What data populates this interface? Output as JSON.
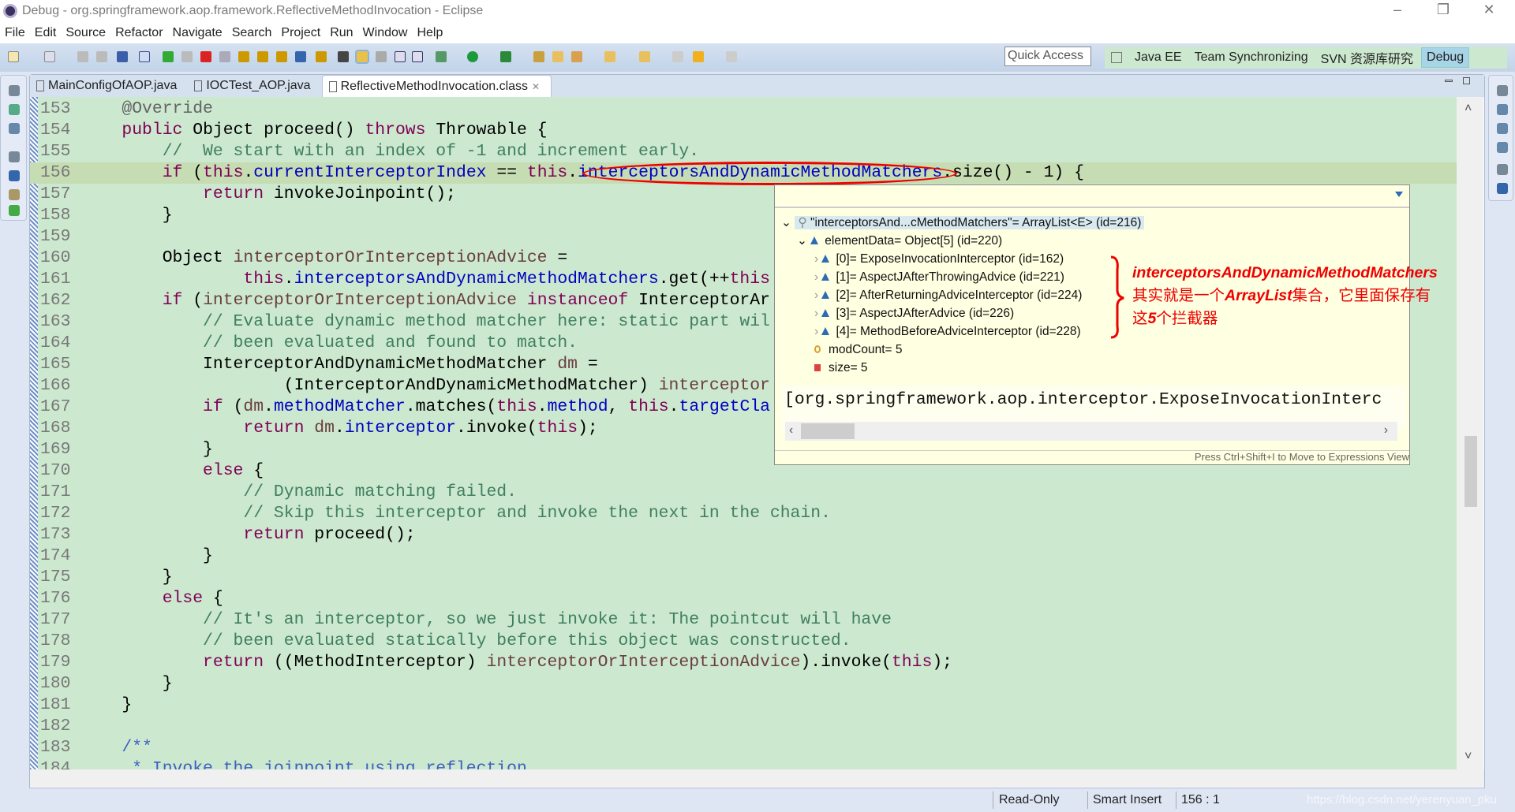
{
  "window": {
    "title": "Debug - org.springframework.aop.framework.ReflectiveMethodInvocation - Eclipse",
    "minimize": "–",
    "restore": "❐",
    "close": "✕"
  },
  "menu": [
    "File",
    "Edit",
    "Source",
    "Refactor",
    "Navigate",
    "Search",
    "Project",
    "Run",
    "Window",
    "Help"
  ],
  "toolbar": {
    "quick_access": "Quick Access",
    "perspectives": [
      "Java EE",
      "Team Synchronizing",
      "SVN 资源库研究",
      "Debug"
    ],
    "active_perspective": "Debug"
  },
  "tabs": [
    {
      "label": "MainConfigOfAOP.java"
    },
    {
      "label": "IOCTest_AOP.java"
    },
    {
      "label": "ReflectiveMethodInvocation.class",
      "active": true,
      "close": "✕"
    }
  ],
  "code": [
    {
      "n": "153",
      "t": [
        [
          "p",
          "    "
        ],
        [
          "a",
          "@Override"
        ]
      ]
    },
    {
      "n": "154",
      "t": [
        [
          "p",
          "    "
        ],
        [
          "k",
          "public"
        ],
        [
          "p",
          " Object proceed() "
        ],
        [
          "k",
          "throws"
        ],
        [
          "p",
          " Throwable {"
        ]
      ]
    },
    {
      "n": "155",
      "t": [
        [
          "p",
          "        "
        ],
        [
          "c",
          "//  We start with an index of -1 and increment early."
        ]
      ]
    },
    {
      "n": "156",
      "hl": true,
      "t": [
        [
          "p",
          "        "
        ],
        [
          "k",
          "if"
        ],
        [
          "p",
          " ("
        ],
        [
          "k",
          "this"
        ],
        [
          "p",
          "."
        ],
        [
          "f",
          "currentInterceptorIndex"
        ],
        [
          "p",
          " == "
        ],
        [
          "k",
          "this"
        ],
        [
          "p",
          "."
        ],
        [
          "f",
          "interceptorsAndDynamicMethodMatchers"
        ],
        [
          "p",
          ".size() - 1) {"
        ]
      ]
    },
    {
      "n": "157",
      "t": [
        [
          "p",
          "            "
        ],
        [
          "k",
          "return"
        ],
        [
          "p",
          " invokeJoinpoint();"
        ]
      ]
    },
    {
      "n": "158",
      "t": [
        [
          "p",
          "        }"
        ]
      ]
    },
    {
      "n": "159",
      "t": []
    },
    {
      "n": "160",
      "t": [
        [
          "p",
          "        Object "
        ],
        [
          "v",
          "interceptorOrInterceptionAdvice"
        ],
        [
          "p",
          " ="
        ]
      ]
    },
    {
      "n": "161",
      "t": [
        [
          "p",
          "                "
        ],
        [
          "k",
          "this"
        ],
        [
          "p",
          "."
        ],
        [
          "f",
          "interceptorsAndDynamicMethodMatchers"
        ],
        [
          "p",
          ".get(++"
        ],
        [
          "k",
          "this"
        ]
      ]
    },
    {
      "n": "162",
      "t": [
        [
          "p",
          "        "
        ],
        [
          "k",
          "if"
        ],
        [
          "p",
          " ("
        ],
        [
          "v",
          "interceptorOrInterceptionAdvice"
        ],
        [
          "p",
          " "
        ],
        [
          "k",
          "instanceof"
        ],
        [
          "p",
          " InterceptorAr"
        ]
      ]
    },
    {
      "n": "163",
      "t": [
        [
          "p",
          "            "
        ],
        [
          "c",
          "// Evaluate dynamic method matcher here: static part wil"
        ]
      ]
    },
    {
      "n": "164",
      "t": [
        [
          "p",
          "            "
        ],
        [
          "c",
          "// been evaluated and found to match."
        ]
      ]
    },
    {
      "n": "165",
      "t": [
        [
          "p",
          "            InterceptorAndDynamicMethodMatcher "
        ],
        [
          "v",
          "dm"
        ],
        [
          "p",
          " ="
        ]
      ]
    },
    {
      "n": "166",
      "t": [
        [
          "p",
          "                    (InterceptorAndDynamicMethodMatcher) "
        ],
        [
          "v",
          "interceptor"
        ]
      ]
    },
    {
      "n": "167",
      "t": [
        [
          "p",
          "            "
        ],
        [
          "k",
          "if"
        ],
        [
          "p",
          " ("
        ],
        [
          "v",
          "dm"
        ],
        [
          "p",
          "."
        ],
        [
          "f",
          "methodMatcher"
        ],
        [
          "p",
          ".matches("
        ],
        [
          "k",
          "this"
        ],
        [
          "p",
          "."
        ],
        [
          "f",
          "method"
        ],
        [
          "p",
          ", "
        ],
        [
          "k",
          "this"
        ],
        [
          "p",
          "."
        ],
        [
          "f",
          "targetCla"
        ]
      ]
    },
    {
      "n": "168",
      "t": [
        [
          "p",
          "                "
        ],
        [
          "k",
          "return"
        ],
        [
          "p",
          " "
        ],
        [
          "v",
          "dm"
        ],
        [
          "p",
          "."
        ],
        [
          "f",
          "interceptor"
        ],
        [
          "p",
          ".invoke("
        ],
        [
          "k",
          "this"
        ],
        [
          "p",
          ");"
        ]
      ]
    },
    {
      "n": "169",
      "t": [
        [
          "p",
          "            }"
        ]
      ]
    },
    {
      "n": "170",
      "t": [
        [
          "p",
          "            "
        ],
        [
          "k",
          "else"
        ],
        [
          "p",
          " {"
        ]
      ]
    },
    {
      "n": "171",
      "t": [
        [
          "p",
          "                "
        ],
        [
          "c",
          "// Dynamic matching failed."
        ]
      ]
    },
    {
      "n": "172",
      "t": [
        [
          "p",
          "                "
        ],
        [
          "c",
          "// Skip this interceptor and invoke the next in the chain."
        ]
      ]
    },
    {
      "n": "173",
      "t": [
        [
          "p",
          "                "
        ],
        [
          "k",
          "return"
        ],
        [
          "p",
          " proceed();"
        ]
      ]
    },
    {
      "n": "174",
      "t": [
        [
          "p",
          "            }"
        ]
      ]
    },
    {
      "n": "175",
      "t": [
        [
          "p",
          "        }"
        ]
      ]
    },
    {
      "n": "176",
      "t": [
        [
          "p",
          "        "
        ],
        [
          "k",
          "else"
        ],
        [
          "p",
          " {"
        ]
      ]
    },
    {
      "n": "177",
      "t": [
        [
          "p",
          "            "
        ],
        [
          "c",
          "// It's an interceptor, so we just invoke it: The pointcut will have"
        ]
      ]
    },
    {
      "n": "178",
      "t": [
        [
          "p",
          "            "
        ],
        [
          "c",
          "// been evaluated statically before this object was constructed."
        ]
      ]
    },
    {
      "n": "179",
      "t": [
        [
          "p",
          "            "
        ],
        [
          "k",
          "return"
        ],
        [
          "p",
          " ((MethodInterceptor) "
        ],
        [
          "v",
          "interceptorOrInterceptionAdvice"
        ],
        [
          "p",
          ").invoke("
        ],
        [
          "k",
          "this"
        ],
        [
          "p",
          ");"
        ]
      ]
    },
    {
      "n": "180",
      "t": [
        [
          "p",
          "        }"
        ]
      ]
    },
    {
      "n": "181",
      "t": [
        [
          "p",
          "    }"
        ]
      ]
    },
    {
      "n": "182",
      "t": []
    },
    {
      "n": "183",
      "t": [
        [
          "p",
          "    "
        ],
        [
          "d",
          "/**"
        ]
      ]
    },
    {
      "n": "184",
      "t": [
        [
          "p",
          "     "
        ],
        [
          "d",
          "* Invoke the joinpoint using reflection."
        ]
      ]
    }
  ],
  "popup": {
    "root": "\"interceptorsAnd...cMethodMatchers\"= ArrayList<E>  (id=216)",
    "elementData": "elementData= Object[5]  (id=220)",
    "items": [
      "[0]= ExposeInvocationInterceptor  (id=162)",
      "[1]= AspectJAfterThrowingAdvice  (id=221)",
      "[2]= AfterReturningAdviceInterceptor  (id=224)",
      "[3]= AspectJAfterAdvice  (id=226)",
      "[4]= MethodBeforeAdviceInterceptor  (id=228)"
    ],
    "modCount": "modCount= 5",
    "size": "size= 5",
    "detail": "[org.springframework.aop.interceptor.ExposeInvocationInterc",
    "footer": "Press Ctrl+Shift+I to Move to Expressions View"
  },
  "annotation": {
    "line1": "interceptorsAndDynamicMethodMatchers",
    "line2a": "其实就是一个",
    "line2b": "ArrayList",
    "line2c": "集合，它里面保存有",
    "line3a": "这",
    "line3b": "5",
    "line3c": "个拦截器",
    "color": "#e00000"
  },
  "status": {
    "mode": "Read-Only",
    "insert": "Smart Insert",
    "position": "156 : 1",
    "watermark": "https://blog.csdn.net/yerenyuan_pku"
  }
}
